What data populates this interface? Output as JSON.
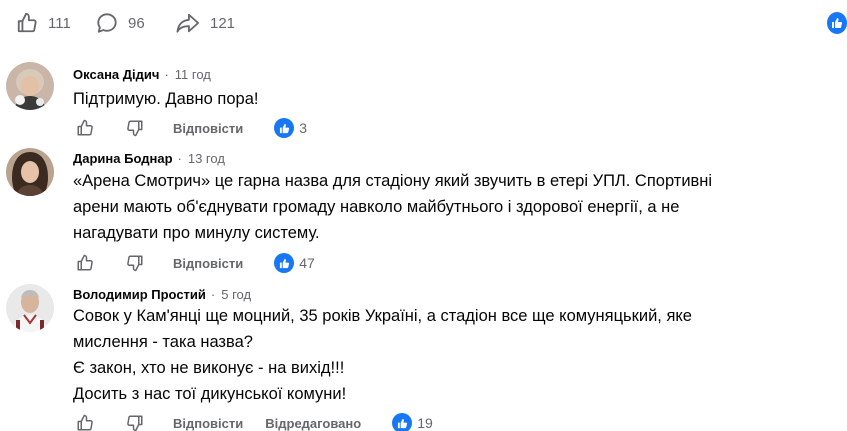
{
  "reactions_bar": {
    "likes": "111",
    "comments": "96",
    "shares": "121"
  },
  "comments": [
    {
      "author": "Оксана Дідич",
      "time": "11 год",
      "lines": [
        "Підтримую. Давно пора!"
      ],
      "reply_label": "Відповісти",
      "reaction_count": "3"
    },
    {
      "author": "Дарина Боднар",
      "time": "13 год",
      "lines": [
        "«Арена Смотрич» це гарна назва для стадіону який звучить в етері УПЛ. Спортивні",
        "арени мають об'єднувати громаду навколо майбутнього і здорової енергії, а не",
        "нагадувати про минулу систему."
      ],
      "reply_label": "Відповісти",
      "reaction_count": "47"
    },
    {
      "author": "Володимир Простий",
      "time": "5 год",
      "lines": [
        "Совок у Кам'янці ще моцний, 35 років Україні, а стадіон все ще комуняцький, яке",
        "мислення - така назва?",
        "Є закон, хто не виконує - на вихід!!!",
        "Досить з нас тої дикунської комуни!"
      ],
      "reply_label": "Відповісти",
      "edited_label": "Відредаговано",
      "reaction_count": "19"
    }
  ],
  "colors": {
    "accent": "#1877f2",
    "secondary_text": "#65676b",
    "primary_text": "#050505"
  },
  "icons": {
    "like": "thumbs-up-icon",
    "dislike": "thumbs-down-icon",
    "comment": "speech-bubble-icon",
    "share": "share-arrow-icon"
  }
}
